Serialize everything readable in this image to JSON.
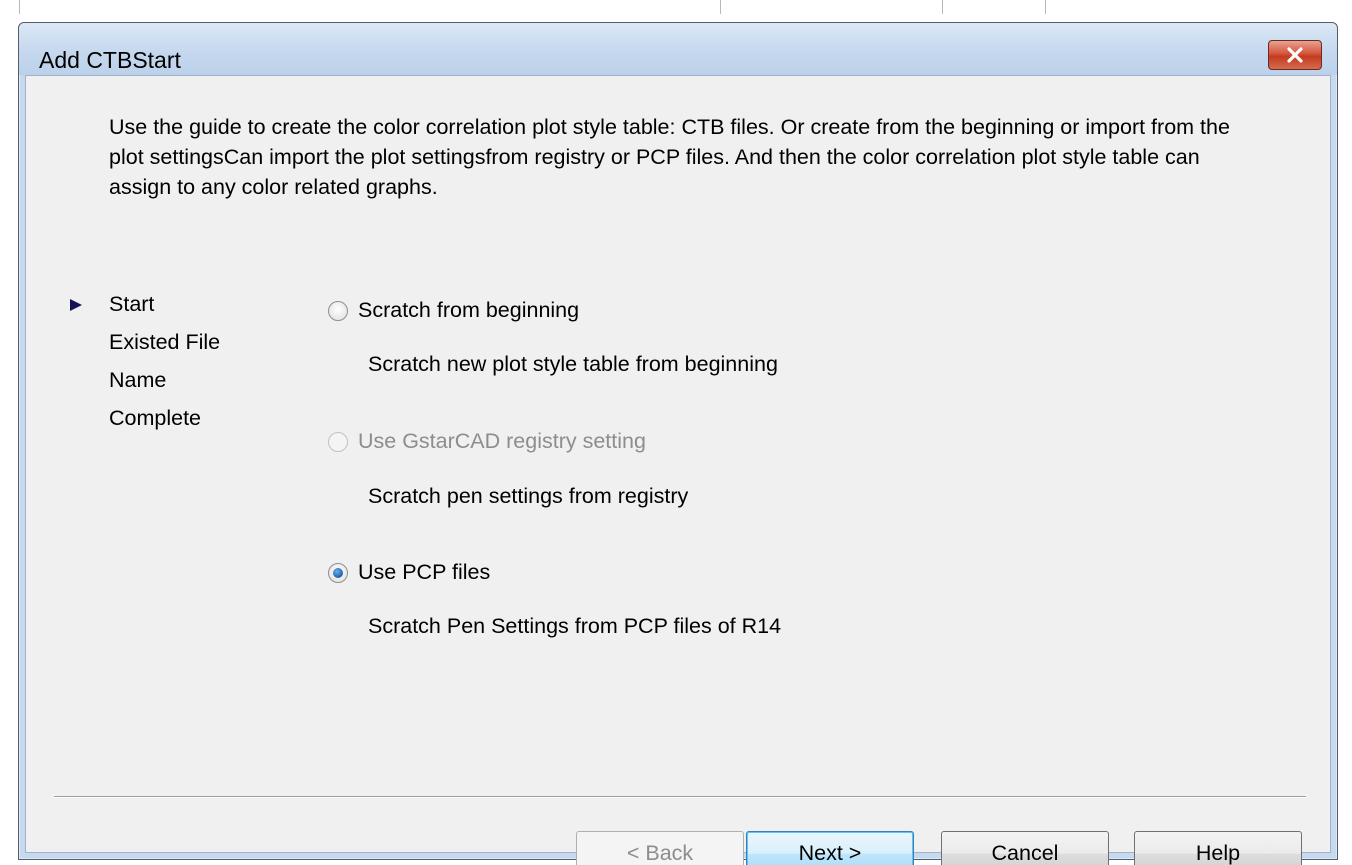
{
  "window": {
    "title": "Add CTBStart"
  },
  "description": "Use the guide to create the color correlation plot style table: CTB files. Or create from the beginning or import from the plot settingsCan import the plot settingsfrom registry or PCP files. And then the color correlation plot style table can assign to any color related graphs.",
  "steps": [
    {
      "label": "Start",
      "current": true
    },
    {
      "label": "Existed File",
      "current": false
    },
    {
      "label": "Name",
      "current": false
    },
    {
      "label": "Complete",
      "current": false
    }
  ],
  "options": [
    {
      "label": "Scratch from beginning",
      "description": "Scratch new plot style table from beginning",
      "checked": false,
      "enabled": true
    },
    {
      "label": "Use GstarCAD registry setting",
      "description": "Scratch pen settings from registry",
      "checked": false,
      "enabled": false
    },
    {
      "label": "Use PCP files",
      "description": "Scratch Pen Settings from PCP files of R14",
      "checked": true,
      "enabled": true
    }
  ],
  "buttons": {
    "back": "< Back",
    "next": "Next >",
    "cancel": "Cancel",
    "help": "Help"
  },
  "icons": {
    "close": "close-icon",
    "current_step": "arrow-right-icon"
  },
  "colors": {
    "close_button": "#c9452a",
    "step_arrow": "#14145a",
    "radio_checked": "#1e5fa8"
  }
}
